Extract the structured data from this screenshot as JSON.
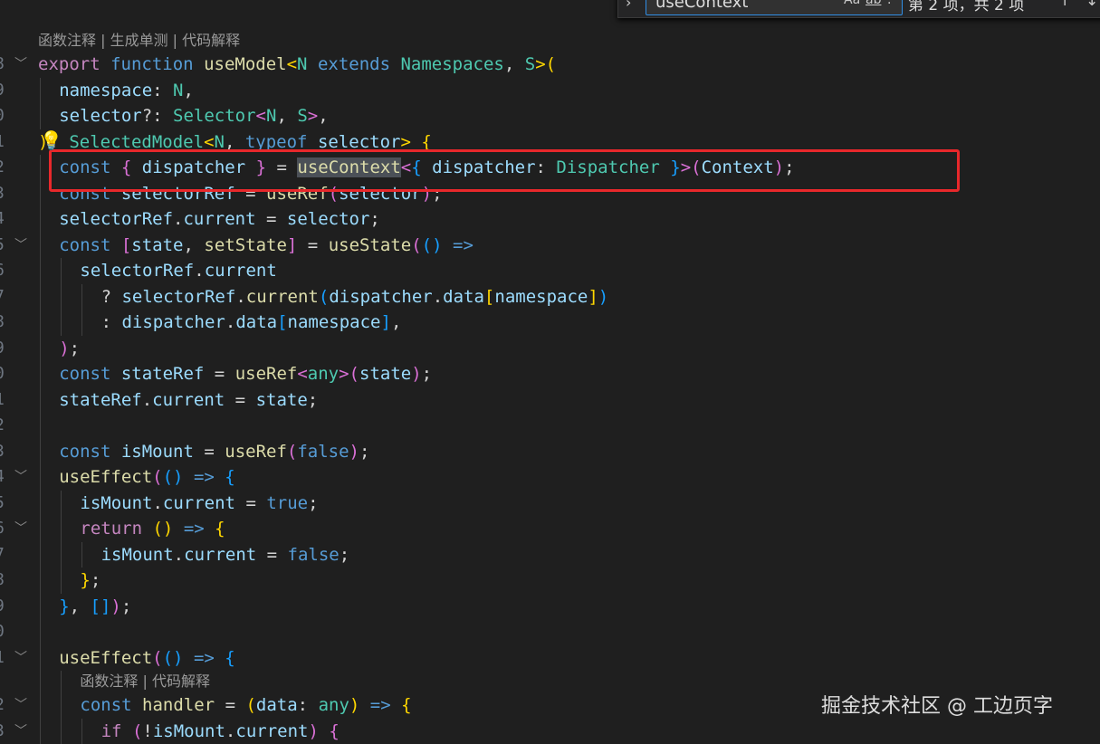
{
  "find_widget": {
    "query": "useContext",
    "match_case_label": "Aa",
    "whole_word_label": "ab",
    "regex_label": ".*",
    "result_count": "第 2 项，共 2 项",
    "prev_icon": "arrow-up-icon",
    "next_icon": "arrow-down-icon"
  },
  "codelens": [
    "函数注释 | 生成单测 | 代码解释",
    "函数注释 | 代码解释"
  ],
  "lines": [
    {
      "n": "8",
      "indent": 0,
      "fold": true,
      "lensBefore": 0,
      "tokens": [
        [
          "export",
          "c"
        ],
        [
          " ",
          "p"
        ],
        [
          "function",
          "k"
        ],
        [
          " ",
          "p"
        ],
        [
          "useModel",
          "f"
        ],
        [
          "<",
          "b1"
        ],
        [
          "N",
          "t"
        ],
        [
          " ",
          "p"
        ],
        [
          "extends",
          "k"
        ],
        [
          " ",
          "p"
        ],
        [
          "Namespaces",
          "t"
        ],
        [
          ", ",
          "p"
        ],
        [
          "S",
          "t"
        ],
        [
          ">(",
          "b1"
        ]
      ]
    },
    {
      "n": "9",
      "indent": 1,
      "tokens": [
        [
          "namespace",
          "v"
        ],
        [
          ": ",
          "p"
        ],
        [
          "N",
          "t"
        ],
        [
          ",",
          "p"
        ]
      ]
    },
    {
      "n": "0",
      "indent": 1,
      "tokens": [
        [
          "selector",
          "v"
        ],
        [
          "?: ",
          "p"
        ],
        [
          "Selector",
          "t"
        ],
        [
          "<",
          "b2"
        ],
        [
          "N",
          "t"
        ],
        [
          ", ",
          "p"
        ],
        [
          "S",
          "t"
        ],
        [
          ">",
          "b2"
        ],
        [
          ",",
          "p"
        ]
      ]
    },
    {
      "n": "1",
      "indent": 0,
      "tokens": [
        [
          ")",
          "b1"
        ],
        [
          ": ",
          "p"
        ],
        [
          "SelectedModel",
          "t"
        ],
        [
          "<",
          "b1"
        ],
        [
          "N",
          "t"
        ],
        [
          ", ",
          "p"
        ],
        [
          "typeof",
          "k"
        ],
        [
          " ",
          "p"
        ],
        [
          "selector",
          "v"
        ],
        [
          ">",
          "b1"
        ],
        [
          " ",
          "p"
        ],
        [
          "{",
          "b1"
        ]
      ]
    },
    {
      "n": "2",
      "indent": 1,
      "tokens": [
        [
          "const",
          "k"
        ],
        [
          " ",
          "p"
        ],
        [
          "{",
          "b2"
        ],
        [
          " ",
          "p"
        ],
        [
          "dispatcher",
          "v"
        ],
        [
          " ",
          "p"
        ],
        [
          "}",
          "b2"
        ],
        [
          " = ",
          "p"
        ],
        [
          "useContext",
          "f hl"
        ],
        [
          "<",
          "b2"
        ],
        [
          "{",
          "b3"
        ],
        [
          " ",
          "p"
        ],
        [
          "dispatcher",
          "v"
        ],
        [
          ": ",
          "p"
        ],
        [
          "Dispatcher",
          "t"
        ],
        [
          " ",
          "p"
        ],
        [
          "}",
          "b3"
        ],
        [
          ">(",
          "b2"
        ],
        [
          "Context",
          "v"
        ],
        [
          ")",
          "b2"
        ],
        [
          ";",
          "p"
        ]
      ]
    },
    {
      "n": "3",
      "indent": 1,
      "tokens": [
        [
          "const",
          "k"
        ],
        [
          " ",
          "p"
        ],
        [
          "selectorRef",
          "v"
        ],
        [
          " = ",
          "p"
        ],
        [
          "useRef",
          "f"
        ],
        [
          "(",
          "b2"
        ],
        [
          "selector",
          "v"
        ],
        [
          ")",
          "b2"
        ],
        [
          ";",
          "p"
        ]
      ]
    },
    {
      "n": "4",
      "indent": 1,
      "tokens": [
        [
          "selectorRef",
          "v"
        ],
        [
          ".",
          "p"
        ],
        [
          "current",
          "v"
        ],
        [
          " = ",
          "p"
        ],
        [
          "selector",
          "v"
        ],
        [
          ";",
          "p"
        ]
      ]
    },
    {
      "n": "5",
      "indent": 1,
      "fold": true,
      "tokens": [
        [
          "const",
          "k"
        ],
        [
          " ",
          "p"
        ],
        [
          "[",
          "b2"
        ],
        [
          "state",
          "v"
        ],
        [
          ", ",
          "p"
        ],
        [
          "setState",
          "f"
        ],
        [
          "]",
          "b2"
        ],
        [
          " = ",
          "p"
        ],
        [
          "useState",
          "f"
        ],
        [
          "(",
          "b2"
        ],
        [
          "()",
          "b3"
        ],
        [
          " ",
          "p"
        ],
        [
          "=>",
          "k"
        ]
      ]
    },
    {
      "n": "6",
      "indent": 2,
      "tokens": [
        [
          "selectorRef",
          "v"
        ],
        [
          ".",
          "p"
        ],
        [
          "current",
          "v"
        ]
      ]
    },
    {
      "n": "7",
      "indent": 3,
      "tokens": [
        [
          "? ",
          "p"
        ],
        [
          "selectorRef",
          "v"
        ],
        [
          ".",
          "p"
        ],
        [
          "current",
          "f"
        ],
        [
          "(",
          "b3"
        ],
        [
          "dispatcher",
          "v"
        ],
        [
          ".",
          "p"
        ],
        [
          "data",
          "v"
        ],
        [
          "[",
          "b1"
        ],
        [
          "namespace",
          "v"
        ],
        [
          "]",
          "b1"
        ],
        [
          ")",
          "b3"
        ]
      ]
    },
    {
      "n": "8",
      "indent": 3,
      "tokens": [
        [
          ": ",
          "p"
        ],
        [
          "dispatcher",
          "v"
        ],
        [
          ".",
          "p"
        ],
        [
          "data",
          "v"
        ],
        [
          "[",
          "b3"
        ],
        [
          "namespace",
          "v"
        ],
        [
          "]",
          "b3"
        ],
        [
          ",",
          "p"
        ]
      ]
    },
    {
      "n": "9",
      "indent": 1,
      "tokens": [
        [
          ")",
          "b2"
        ],
        [
          ";",
          "p"
        ]
      ]
    },
    {
      "n": "0",
      "indent": 1,
      "tokens": [
        [
          "const",
          "k"
        ],
        [
          " ",
          "p"
        ],
        [
          "stateRef",
          "v"
        ],
        [
          " = ",
          "p"
        ],
        [
          "useRef",
          "f"
        ],
        [
          "<",
          "b2"
        ],
        [
          "any",
          "t"
        ],
        [
          ">(",
          "b2"
        ],
        [
          "state",
          "v"
        ],
        [
          ")",
          "b2"
        ],
        [
          ";",
          "p"
        ]
      ]
    },
    {
      "n": "1",
      "indent": 1,
      "tokens": [
        [
          "stateRef",
          "v"
        ],
        [
          ".",
          "p"
        ],
        [
          "current",
          "v"
        ],
        [
          " = ",
          "p"
        ],
        [
          "state",
          "v"
        ],
        [
          ";",
          "p"
        ]
      ]
    },
    {
      "n": "2",
      "indent": 1,
      "tokens": []
    },
    {
      "n": "3",
      "indent": 1,
      "tokens": [
        [
          "const",
          "k"
        ],
        [
          " ",
          "p"
        ],
        [
          "isMount",
          "v"
        ],
        [
          " = ",
          "p"
        ],
        [
          "useRef",
          "f"
        ],
        [
          "(",
          "b2"
        ],
        [
          "false",
          "k"
        ],
        [
          ")",
          "b2"
        ],
        [
          ";",
          "p"
        ]
      ]
    },
    {
      "n": "4",
      "indent": 1,
      "fold": true,
      "tokens": [
        [
          "useEffect",
          "f"
        ],
        [
          "(",
          "b2"
        ],
        [
          "()",
          "b3"
        ],
        [
          " ",
          "p"
        ],
        [
          "=>",
          "k"
        ],
        [
          " ",
          "p"
        ],
        [
          "{",
          "b3"
        ]
      ]
    },
    {
      "n": "5",
      "indent": 2,
      "tokens": [
        [
          "isMount",
          "v"
        ],
        [
          ".",
          "p"
        ],
        [
          "current",
          "v"
        ],
        [
          " = ",
          "p"
        ],
        [
          "true",
          "k"
        ],
        [
          ";",
          "p"
        ]
      ]
    },
    {
      "n": "6",
      "indent": 2,
      "fold": true,
      "tokens": [
        [
          "return",
          "c"
        ],
        [
          " ",
          "p"
        ],
        [
          "()",
          "b1"
        ],
        [
          " ",
          "p"
        ],
        [
          "=>",
          "k"
        ],
        [
          " ",
          "p"
        ],
        [
          "{",
          "b1"
        ]
      ]
    },
    {
      "n": "7",
      "indent": 3,
      "tokens": [
        [
          "isMount",
          "v"
        ],
        [
          ".",
          "p"
        ],
        [
          "current",
          "v"
        ],
        [
          " = ",
          "p"
        ],
        [
          "false",
          "k"
        ],
        [
          ";",
          "p"
        ]
      ]
    },
    {
      "n": "8",
      "indent": 2,
      "tokens": [
        [
          "}",
          "b1"
        ],
        [
          ";",
          "p"
        ]
      ]
    },
    {
      "n": "9",
      "indent": 1,
      "tokens": [
        [
          "}",
          "b3"
        ],
        [
          ", ",
          "p"
        ],
        [
          "[]",
          "b3"
        ],
        [
          ")",
          "b2"
        ],
        [
          ";",
          "p"
        ]
      ]
    },
    {
      "n": "0",
      "indent": 1,
      "tokens": []
    },
    {
      "n": "1",
      "indent": 1,
      "fold": true,
      "tokens": [
        [
          "useEffect",
          "f"
        ],
        [
          "(",
          "b2"
        ],
        [
          "()",
          "b3"
        ],
        [
          " ",
          "p"
        ],
        [
          "=>",
          "k"
        ],
        [
          " ",
          "p"
        ],
        [
          "{",
          "b3"
        ]
      ]
    },
    {
      "n": "2",
      "indent": 2,
      "fold": true,
      "lensBefore": 1,
      "tokens": [
        [
          "const",
          "k"
        ],
        [
          " ",
          "p"
        ],
        [
          "handler",
          "f"
        ],
        [
          " = ",
          "p"
        ],
        [
          "(",
          "b1"
        ],
        [
          "data",
          "v"
        ],
        [
          ": ",
          "p"
        ],
        [
          "any",
          "t"
        ],
        [
          ")",
          "b1"
        ],
        [
          " ",
          "p"
        ],
        [
          "=>",
          "k"
        ],
        [
          " ",
          "p"
        ],
        [
          "{",
          "b1"
        ]
      ]
    },
    {
      "n": "3",
      "indent": 3,
      "fold": true,
      "tokens": [
        [
          "if",
          "c"
        ],
        [
          " ",
          "p"
        ],
        [
          "(",
          "b2"
        ],
        [
          "!",
          "p"
        ],
        [
          "isMount",
          "v"
        ],
        [
          ".",
          "p"
        ],
        [
          "current",
          "v"
        ],
        [
          ")",
          "b2"
        ],
        [
          " ",
          "p"
        ],
        [
          "{",
          "b2"
        ]
      ]
    }
  ],
  "watermark": "掘金技术社区 @ 工边页字",
  "colors": {
    "background": "#1f1f1f",
    "highlight_box": "#e8282b",
    "find_border": "#2f8de4"
  }
}
